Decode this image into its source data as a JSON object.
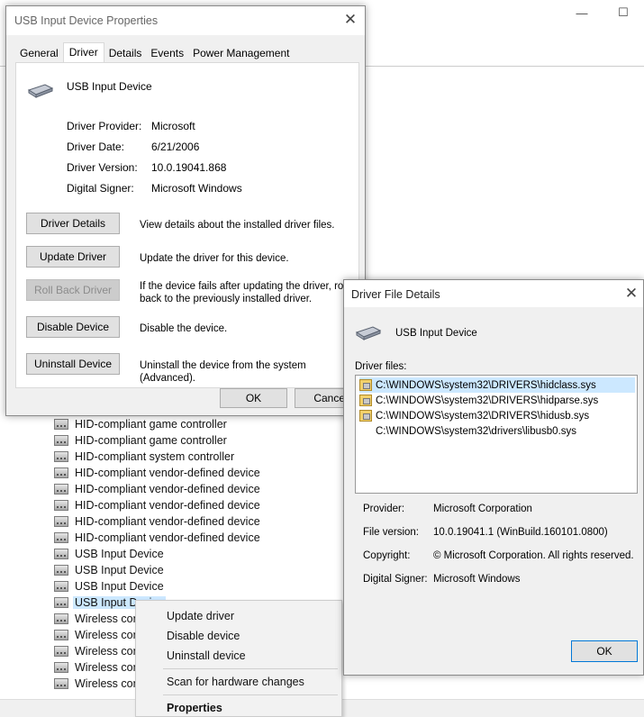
{
  "background": {
    "window_controls": {
      "minimize": "—",
      "maximize": "☐"
    },
    "tree_items": [
      {
        "label": "HID-compliant game controller"
      },
      {
        "label": "HID-compliant game controller"
      },
      {
        "label": "HID-compliant system controller"
      },
      {
        "label": "HID-compliant vendor-defined device"
      },
      {
        "label": "HID-compliant vendor-defined device"
      },
      {
        "label": "HID-compliant vendor-defined device"
      },
      {
        "label": "HID-compliant vendor-defined device"
      },
      {
        "label": "HID-compliant vendor-defined device"
      },
      {
        "label": "USB Input Device"
      },
      {
        "label": "USB Input Device"
      },
      {
        "label": "USB Input Device"
      },
      {
        "label": "USB Input Device",
        "selected": true
      },
      {
        "label": "Wireless cont"
      },
      {
        "label": "Wireless cont"
      },
      {
        "label": "Wireless cont"
      },
      {
        "label": "Wireless cont"
      },
      {
        "label": "Wireless cont"
      }
    ]
  },
  "context_menu": {
    "items": [
      "Update driver",
      "Disable device",
      "Uninstall device"
    ],
    "scan": "Scan for hardware changes",
    "properties": "Properties"
  },
  "properties_dialog": {
    "title": "USB Input Device Properties",
    "close": "✕",
    "tabs": [
      "General",
      "Driver",
      "Details",
      "Events",
      "Power Management"
    ],
    "active_tab": "Driver",
    "device_name": "USB Input Device",
    "fields": [
      {
        "label": "Driver Provider:",
        "value": "Microsoft"
      },
      {
        "label": "Driver Date:",
        "value": "6/21/2006"
      },
      {
        "label": "Driver Version:",
        "value": "10.0.19041.868"
      },
      {
        "label": "Digital Signer:",
        "value": "Microsoft Windows"
      }
    ],
    "actions": [
      {
        "button": "Driver Details",
        "desc": "View details about the installed driver files.",
        "disabled": false
      },
      {
        "button": "Update Driver",
        "desc": "Update the driver for this device.",
        "disabled": false
      },
      {
        "button": "Roll Back Driver",
        "desc": "If the device fails after updating the driver, roll back to the previously installed driver.",
        "disabled": true
      },
      {
        "button": "Disable Device",
        "desc": "Disable the device.",
        "disabled": false
      },
      {
        "button": "Uninstall Device",
        "desc": "Uninstall the device from the system (Advanced).",
        "disabled": false
      }
    ],
    "ok": "OK",
    "cancel": "Cancel"
  },
  "driver_file_details": {
    "title": "Driver File Details",
    "close": "✕",
    "device_name": "USB Input Device",
    "files_label": "Driver files:",
    "files": [
      {
        "path": "C:\\WINDOWS\\system32\\DRIVERS\\hidclass.sys",
        "selected": true,
        "icon": "system-file-icon"
      },
      {
        "path": "C:\\WINDOWS\\system32\\DRIVERS\\hidparse.sys",
        "selected": false,
        "icon": "system-file-icon"
      },
      {
        "path": "C:\\WINDOWS\\system32\\DRIVERS\\hidusb.sys",
        "selected": false,
        "icon": "system-file-icon"
      },
      {
        "path": "C:\\WINDOWS\\system32\\drivers\\libusb0.sys",
        "selected": false,
        "icon": "none"
      }
    ],
    "info": [
      {
        "label": "Provider:",
        "value": "Microsoft Corporation"
      },
      {
        "label": "File version:",
        "value": "10.0.19041.1 (WinBuild.160101.0800)"
      },
      {
        "label": "Copyright:",
        "value": "© Microsoft Corporation. All rights reserved."
      },
      {
        "label": "Digital Signer:",
        "value": "Microsoft Windows"
      }
    ],
    "ok": "OK"
  },
  "colors": {
    "selection": "#cce8ff",
    "accent": "#0078d7",
    "dialog_bg": "#f0f0f0"
  }
}
